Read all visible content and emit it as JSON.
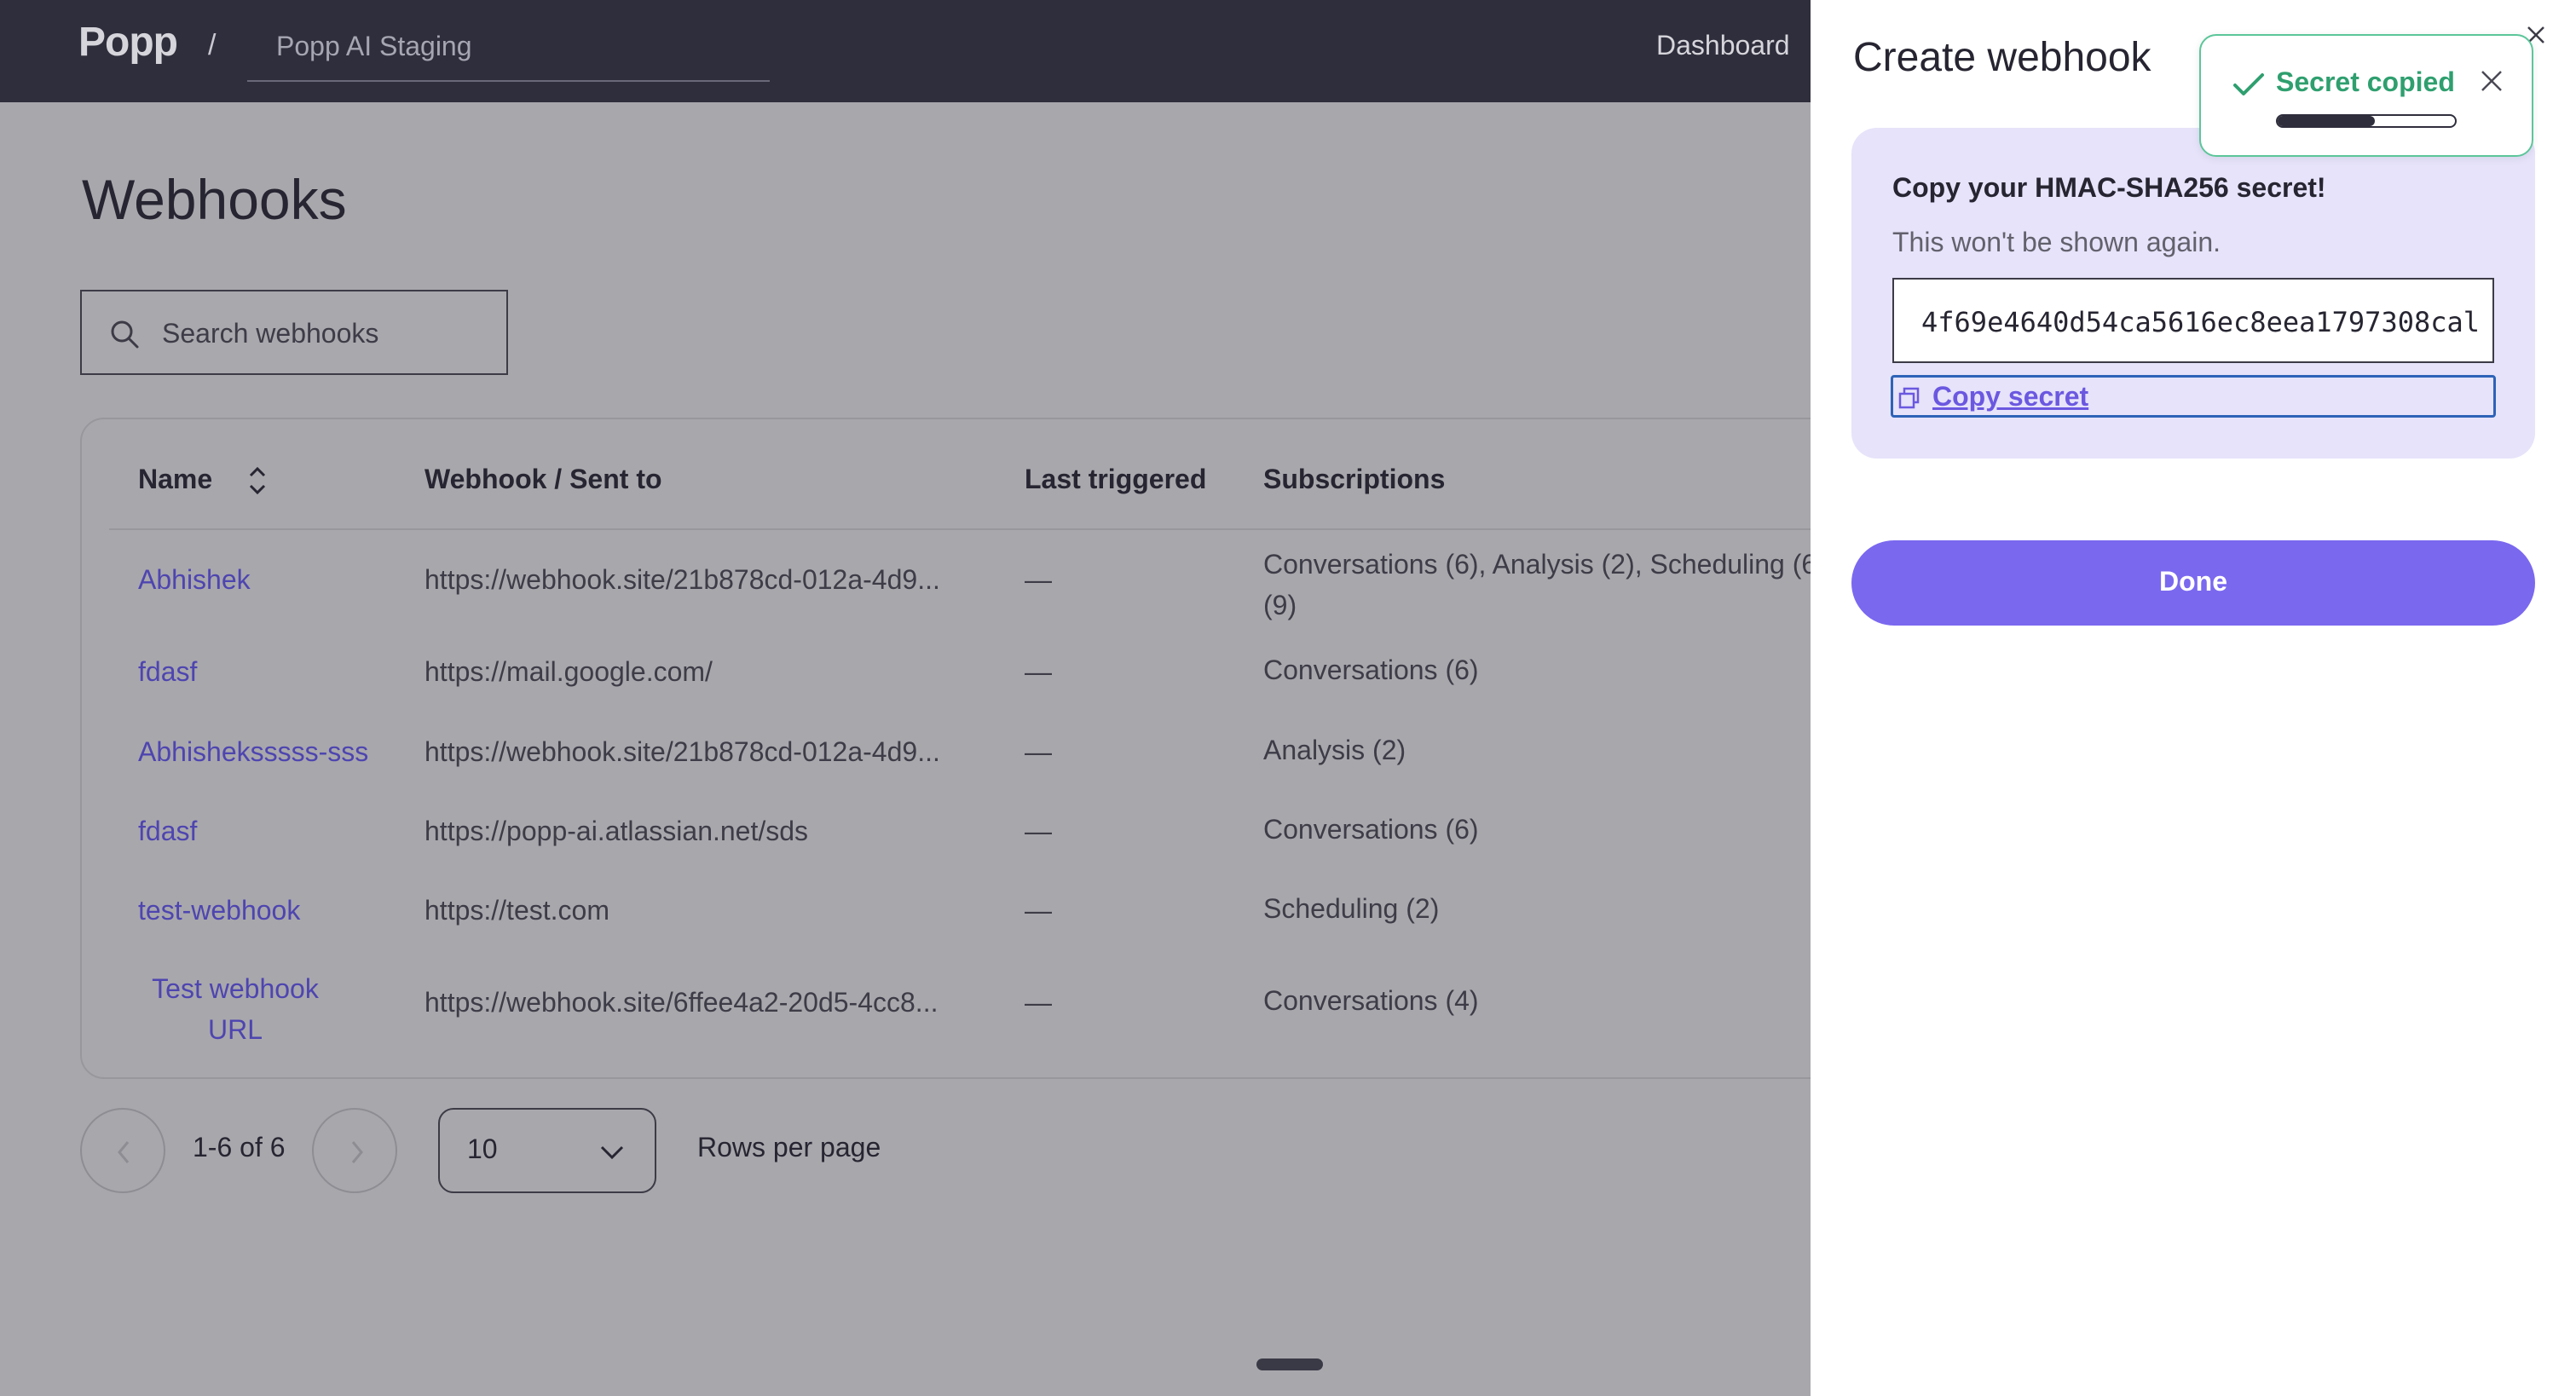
{
  "topbar": {
    "logo": "Popp",
    "separator": "/",
    "org_name": "Popp AI Staging",
    "nav_dashboard": "Dashboard"
  },
  "page": {
    "title": "Webhooks",
    "search_placeholder": "Search webhooks"
  },
  "table": {
    "columns": [
      "Name",
      "Webhook / Sent to",
      "Last triggered",
      "Subscriptions"
    ],
    "rows": [
      {
        "name": "Abhishek",
        "url": "https://webhook.site/21b878cd-012a-4d9...",
        "last": "—",
        "subs": "Conversations (6), Analysis (2), Scheduling (6",
        "subs2": "(9)"
      },
      {
        "name": "fdasf",
        "url": "https://mail.google.com/",
        "last": "—",
        "subs": "Conversations (6)"
      },
      {
        "name": "Abhisheksssss-sss",
        "url": "https://webhook.site/21b878cd-012a-4d9...",
        "last": "—",
        "subs": "Analysis (2)"
      },
      {
        "name": "fdasf",
        "url": "https://popp-ai.atlassian.net/sds",
        "last": "—",
        "subs": "Conversations (6)"
      },
      {
        "name": "test-webhook",
        "url": "https://test.com",
        "last": "—",
        "subs": "Scheduling (2)"
      },
      {
        "name": "Test webhook",
        "name2": "URL",
        "url": "https://webhook.site/6ffee4a2-20d5-4cc8...",
        "last": "—",
        "subs": "Conversations (4)"
      }
    ]
  },
  "pagination": {
    "range": "1-6 of 6",
    "rows_per_page_value": "10",
    "rows_per_page_label": "Rows per page"
  },
  "drawer": {
    "title": "Create webhook",
    "secret_heading": "Copy your HMAC-SHA256 secret!",
    "secret_subtext": "This won't be shown again.",
    "secret_value": "4f69e4640d54ca5616ec8eea1797308cal",
    "copy_label": "Copy secret",
    "done_label": "Done"
  },
  "toast": {
    "message": "Secret copied",
    "progress": 0.55
  },
  "colors": {
    "accent": "#7a68ef",
    "link": "#4e45b0",
    "success": "#2f9f6f",
    "topbar": "#2f2e3c"
  }
}
